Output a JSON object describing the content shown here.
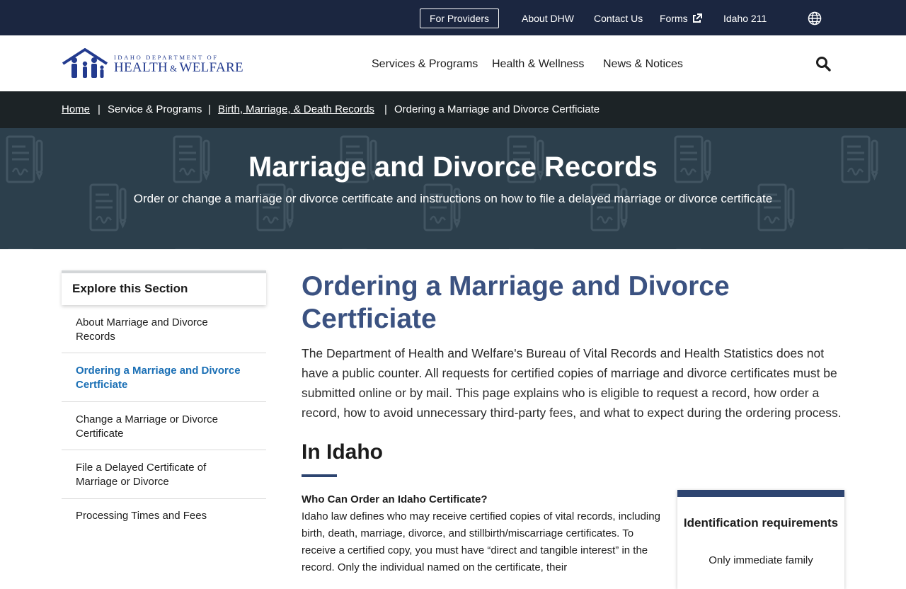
{
  "topbar": {
    "providers_label": "For Providers",
    "links": [
      "About DHW",
      "Contact Us",
      "Forms",
      "Idaho 211"
    ],
    "forms_icon": "external-link-icon",
    "language_icon": "globe-icon"
  },
  "header": {
    "logo_top": "IDAHO DEPARTMENT OF",
    "logo_left": "HEALTH",
    "logo_amp": "&",
    "logo_right": "WELFARE",
    "nav": [
      "Services & Programs",
      "Health & Wellness",
      "News & Notices"
    ],
    "search_icon": "search-icon"
  },
  "breadcrumb": {
    "home": "Home",
    "services": "Service & Programs",
    "records": "Birth, Marriage, & Death Records",
    "current": "Ordering a Marriage and Divorce Certficiate",
    "separator": "|"
  },
  "hero": {
    "title": "Marriage and Divorce Records",
    "subtitle": "Order or change a marriage or divorce certificate and instructions on how to file a delayed marriage or divorce certificate"
  },
  "sidebar": {
    "heading": "Explore this Section",
    "items": [
      "About Marriage and Divorce Records",
      "Ordering a Marriage and Divorce Certficiate",
      "Change a Marriage or Divorce Certificate",
      "File a Delayed Certificate of Marriage or Divorce",
      "Processing Times and Fees"
    ],
    "active_index": 1
  },
  "main": {
    "title": "Ordering a Marriage and Divorce Certficiate",
    "intro": "The Department of Health and Welfare's Bureau of Vital Records and Health Statistics does not have a public counter. All requests for certified copies of marriage and divorce certificates must be submitted online or by mail. This page explains who is eligible to request a record, how order a record, how to avoid unnecessary third-party fees, and what to expect during the ordering process.",
    "section_title": "In Idaho",
    "subheading": "Who Can Order an Idaho Certificate?",
    "paragraph": "Idaho law defines who may receive certified copies of vital records, including birth, death, marriage, divorce, and stillbirth/miscarriage certificates. To receive a certified copy, you must have “direct and tangible interest” in the record. Only the individual named on the certificate, their",
    "id_box_title": "Identification requirements",
    "id_box_text": "Only immediate family"
  },
  "colors": {
    "topbar": "#1b2640",
    "breadcrumb": "#1c2326",
    "hero": "#2c3f4c",
    "heading_blue": "#3b5281",
    "active_link": "#1a6fb5",
    "logo_blue": "#233b8f"
  }
}
